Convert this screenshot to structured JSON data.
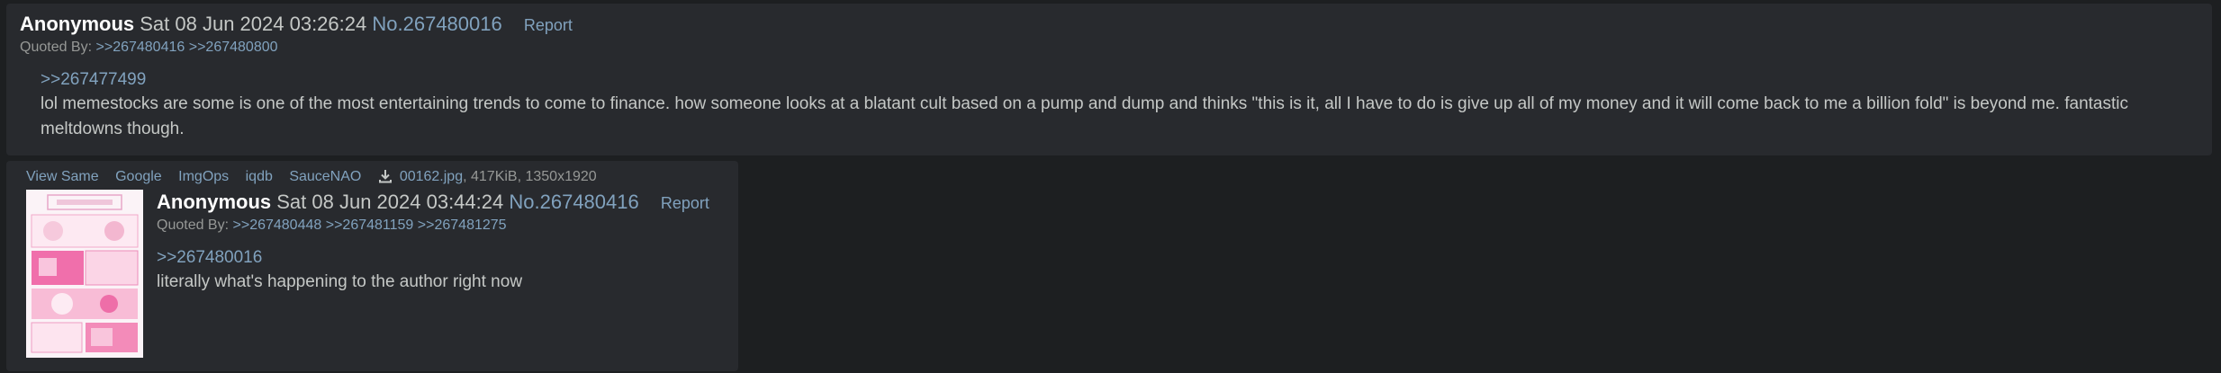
{
  "posts": [
    {
      "name": "Anonymous",
      "date": "Sat 08 Jun 2024 03:26:24",
      "number": "No.267480016",
      "report": "Report",
      "quoted_by_label": "Quoted By:",
      "quoted_by": [
        ">>267480416",
        ">>267480800"
      ],
      "reply_to": ">>267477499",
      "text": "lol memestocks are some is one of the most entertaining trends to come to finance. how someone looks at a blatant cult based on a pump and dump and thinks \"this is it, all I have to do is give up all of my money and it will come back to me a billion fold\" is beyond me. fantastic meltdowns though."
    },
    {
      "file_links": [
        "View Same",
        "Google",
        "ImgOps",
        "iqdb",
        "SauceNAO"
      ],
      "download_icon": "download-icon",
      "file_name": "00162.jpg",
      "file_info": ", 417KiB, 1350x1920",
      "name": "Anonymous",
      "date": "Sat 08 Jun 2024 03:44:24",
      "number": "No.267480416",
      "report": "Report",
      "quoted_by_label": "Quoted By:",
      "quoted_by": [
        ">>267480448",
        ">>267481159",
        ">>267481275"
      ],
      "reply_to": ">>267480016",
      "text": "literally what's happening to the author right now"
    }
  ],
  "colors": {
    "background": "#1d1f21",
    "post_background": "#282a2e",
    "link": "#81a2be",
    "text": "#c5c8c6",
    "name": "#ffffff"
  }
}
